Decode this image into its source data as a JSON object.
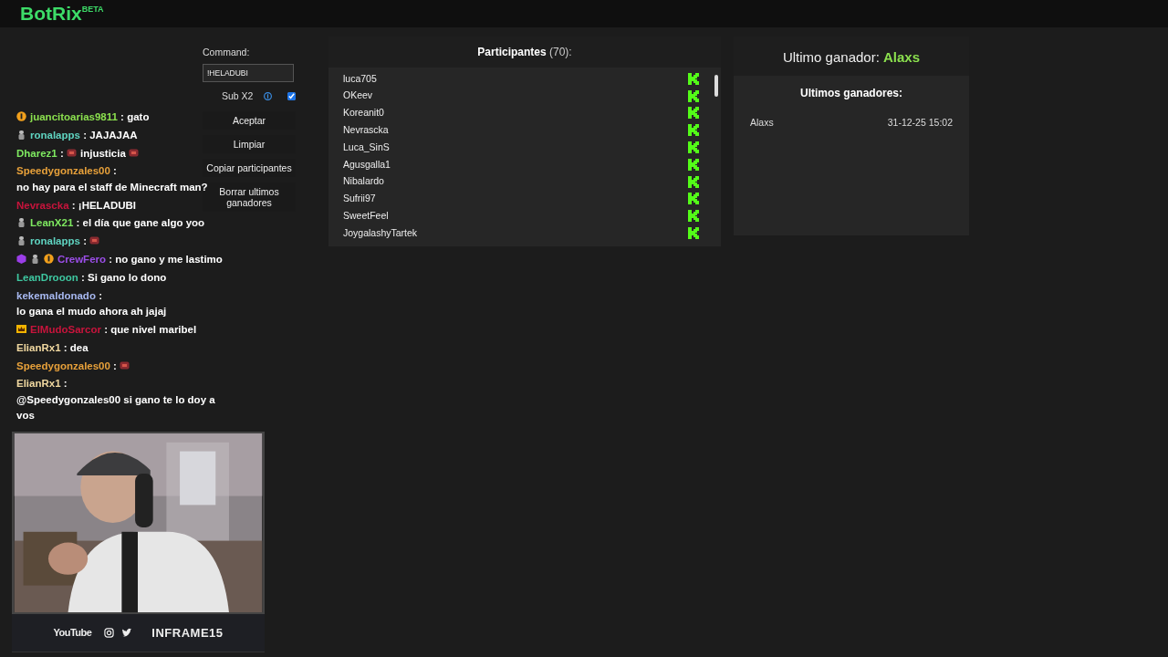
{
  "brand": {
    "name": "BotRix",
    "tag": "BETA"
  },
  "command": {
    "label": "Command:",
    "value": "!HELADUBI"
  },
  "sub_x2": {
    "label": "Sub X2",
    "checked": true
  },
  "buttons": [
    "Aceptar",
    "Limpiar",
    "Copiar participantes",
    "Borrar ultimos ganadores"
  ],
  "participants": {
    "title": "Participantes",
    "count": "(70):",
    "items": [
      "luca705",
      "OKeev",
      "Koreanit0",
      "Nevrascka",
      "Luca_SinS",
      "Agusgalla1",
      "Nibalardo",
      "Sufrii97",
      "SweetFeel",
      "JoygalashyTartek"
    ]
  },
  "last_winner": {
    "label": "Ultimo ganador:",
    "name": "Alaxs"
  },
  "winners": {
    "title": "Ultimos ganadores:",
    "rows": [
      {
        "name": "Alaxs",
        "date": "31-12-25 15:02"
      }
    ]
  },
  "chat": [
    {
      "badges": [
        {
          "kind": "coin"
        }
      ],
      "user": "juancitoarias9811",
      "color": "#8be04e",
      "sep": ":",
      "parts": [
        {
          "kind": "text",
          "text": "gato"
        }
      ]
    },
    {
      "badges": [
        {
          "kind": "figure"
        }
      ],
      "user": "ronalapps",
      "color": "#5fd3c0",
      "sep": ":",
      "parts": [
        {
          "kind": "text",
          "text": "JAJAJAA"
        }
      ]
    },
    {
      "user": "Dharez1",
      "color": "#7ee860",
      "sep": ":",
      "parts": [
        {
          "kind": "emote"
        },
        {
          "kind": "text",
          "text": "injusticia"
        },
        {
          "kind": "emote"
        }
      ]
    },
    {
      "user": "Speedygonzales00",
      "color": "#e8a13a",
      "sep": ":",
      "parts": [
        {
          "kind": "text",
          "text": "no hay para el staff de Minecraft man?"
        }
      ]
    },
    {
      "user": "Nevrascka",
      "color": "#c8143c",
      "sep": ":",
      "parts": [
        {
          "kind": "text",
          "text": "¡HELADUBI"
        }
      ]
    },
    {
      "badges": [
        {
          "kind": "figure"
        }
      ],
      "user": "LeanX21",
      "color": "#7ee860",
      "sep": ":",
      "parts": [
        {
          "kind": "text",
          "text": "el día que gane algo yoo"
        }
      ]
    },
    {
      "badges": [
        {
          "kind": "figure"
        }
      ],
      "user": "ronalapps",
      "color": "#5fd3c0",
      "sep": ":",
      "parts": [
        {
          "kind": "emote"
        }
      ]
    },
    {
      "badges": [
        {
          "kind": "cube"
        },
        {
          "kind": "figure"
        },
        {
          "kind": "coin"
        }
      ],
      "user": "CrewFero",
      "color": "#9b4ee8",
      "sep": ":",
      "parts": [
        {
          "kind": "text",
          "text": "no gano y me lastimo"
        }
      ]
    },
    {
      "user": "LeanDrooon",
      "color": "#3ec7a0",
      "sep": ":",
      "parts": [
        {
          "kind": "text",
          "text": "Si gano lo dono"
        }
      ]
    },
    {
      "user": "kekemaldonado",
      "color": "#a7b8f0",
      "sep": ":",
      "parts": [
        {
          "kind": "text",
          "text": "lo gana el mudo ahora ah jajaj"
        }
      ]
    },
    {
      "badges": [
        {
          "kind": "crown"
        }
      ],
      "user": "ElMudoSarcor",
      "color": "#c8143c",
      "sep": ":",
      "parts": [
        {
          "kind": "text",
          "text": "que nivel maribel"
        }
      ]
    },
    {
      "user": "ElianRx1",
      "color": "#f0d8a0",
      "sep": ":",
      "parts": [
        {
          "kind": "text",
          "text": "dea"
        }
      ]
    },
    {
      "user": "Speedygonzales00",
      "color": "#e8a13a",
      "sep": ":",
      "parts": [
        {
          "kind": "emote"
        }
      ]
    },
    {
      "user": "ElianRx1",
      "color": "#f0d8a0",
      "sep": ":",
      "parts": [
        {
          "kind": "text",
          "text": "@Speedygonzales00 si gano te lo doy a vos"
        }
      ]
    }
  ],
  "socials": {
    "youtube": "YouTube",
    "handle": "INFRAME15"
  }
}
